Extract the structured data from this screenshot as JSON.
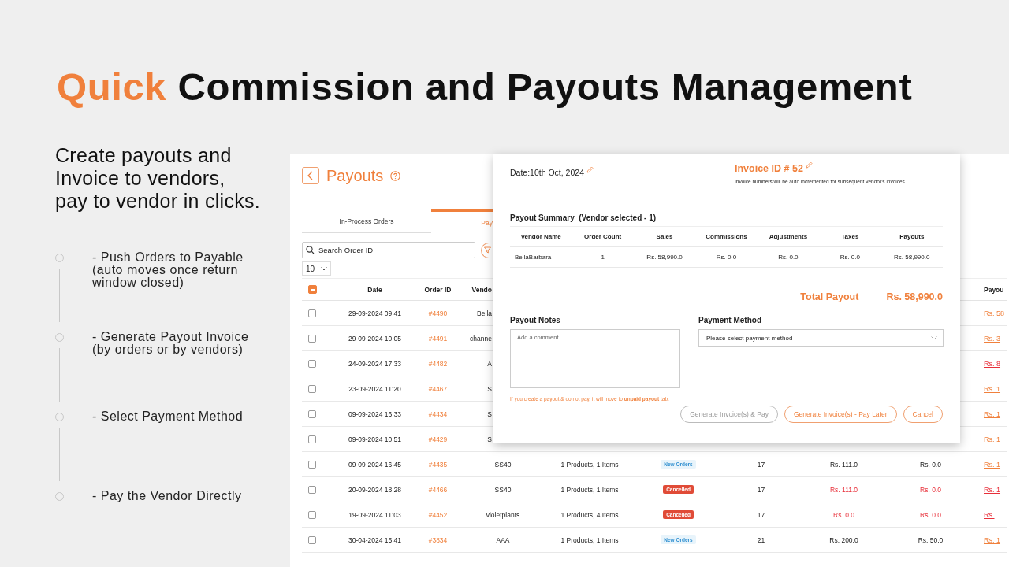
{
  "headline": {
    "highlight": "Quick",
    "rest": "Commission and Payouts Management"
  },
  "intro": "Create payouts and\nInvoice to vendors,\npay to vendor in clicks.",
  "steps": [
    "- Push Orders to Payable\n(auto moves once return\nwindow closed)",
    "- Generate Payout Invoice\n(by orders or by vendors)",
    "- Select Payment Method",
    "- Pay the Vendor Directly"
  ],
  "app": {
    "title": "Payouts",
    "tabs": [
      {
        "label": "In-Process Orders",
        "selected": false
      },
      {
        "label": "Pay",
        "selected": true
      }
    ],
    "search": {
      "placeholder": "Search Order ID"
    },
    "page_size": "10",
    "table": {
      "all_partial": true,
      "columns": [
        "Date",
        "Order ID",
        "Vendo",
        "Payou"
      ],
      "rows": [
        {
          "checked": false,
          "alert": false,
          "date": "29-09-2024 09:41",
          "order_id": "#4490",
          "vendor": "Bella",
          "payout": "Rs. 58"
        },
        {
          "checked": false,
          "alert": false,
          "date": "29-09-2024 10:05",
          "order_id": "#4491",
          "vendor": "channe",
          "payout": "Rs. 3"
        },
        {
          "checked": false,
          "alert": true,
          "date": "24-09-2024 17:33",
          "order_id": "#4482",
          "vendor": "A",
          "payout": "Rs. 8"
        },
        {
          "checked": false,
          "alert": false,
          "date": "23-09-2024 11:20",
          "order_id": "#4467",
          "vendor": "S",
          "payout": "Rs. 1"
        },
        {
          "checked": false,
          "alert": false,
          "date": "09-09-2024 16:33",
          "order_id": "#4434",
          "vendor": "S",
          "payout": "Rs. 1"
        },
        {
          "checked": false,
          "alert": false,
          "date": "09-09-2024 10:51",
          "order_id": "#4429",
          "vendor": "S",
          "payout": "Rs. 1"
        },
        {
          "checked": false,
          "alert": false,
          "date": "09-09-2024 16:45",
          "order_id": "#4435",
          "vendor": "SS40",
          "products": "1 Products, 1 Items",
          "status": {
            "label": "New Orders",
            "kind": "new"
          },
          "count": "17",
          "amount": "Rs. 111.0",
          "commission": "Rs. 0.0",
          "payout": "Rs. 1"
        },
        {
          "checked": false,
          "alert": true,
          "date": "20-09-2024 18:28",
          "order_id": "#4466",
          "vendor": "SS40",
          "products": "1 Products, 1 Items",
          "status": {
            "label": "Cancelled",
            "kind": "cancelled"
          },
          "count": "17",
          "amount": "Rs. 111.0",
          "commission": "Rs. 0.0",
          "payout": "Rs. 1"
        },
        {
          "checked": false,
          "alert": true,
          "date": "19-09-2024 11:03",
          "order_id": "#4452",
          "vendor": "violetplants",
          "products": "1 Products, 4 Items",
          "status": {
            "label": "Cancelled",
            "kind": "cancelled"
          },
          "count": "17",
          "amount": "Rs. 0.0",
          "commission": "Rs. 0.0",
          "payout": "Rs."
        },
        {
          "checked": false,
          "alert": false,
          "date": "30-04-2024 15:41",
          "order_id": "#3834",
          "vendor": "AAA",
          "products": "1 Products, 1 Items",
          "status": {
            "label": "New Orders",
            "kind": "new"
          },
          "count": "21",
          "amount": "Rs. 200.0",
          "commission": "Rs. 50.0",
          "payout": "Rs. 1"
        }
      ]
    }
  },
  "modal": {
    "date": "Date:10th Oct, 2024",
    "invoice_id": "Invoice ID # 52",
    "invoice_note": "Invoice numbers will be auto incremented for subsequent vendor's invoices.",
    "summary_title": "Payout Summary  (Vendor selected - 1)",
    "summary_columns": [
      "Vendor Name",
      "Order Count",
      "Sales",
      "Commissions",
      "Adjustments",
      "Taxes",
      "Payouts"
    ],
    "summary_rows": [
      [
        "BellaBarbara",
        "1",
        "Rs. 58,990.0",
        "Rs. 0.0",
        "Rs. 0.0",
        "Rs. 0.0",
        "Rs. 58,990.0"
      ]
    ],
    "total_label": "Total Payout",
    "total_value": "Rs. 58,990.0",
    "notes_label": "Payout Notes",
    "notes_placeholder": "Add a comment....",
    "method_label": "Payment Method",
    "method_placeholder": "Please select payment method",
    "warning": "If you create a payout & do not pay, it will move to **unpaid payout** tab.",
    "buttons": [
      {
        "label": "Generate Invoice(s) & Pay",
        "disabled": true
      },
      {
        "label": "Generate Invoice(s) - Pay Later",
        "disabled": false
      },
      {
        "label": "Cancel",
        "disabled": false
      }
    ]
  }
}
